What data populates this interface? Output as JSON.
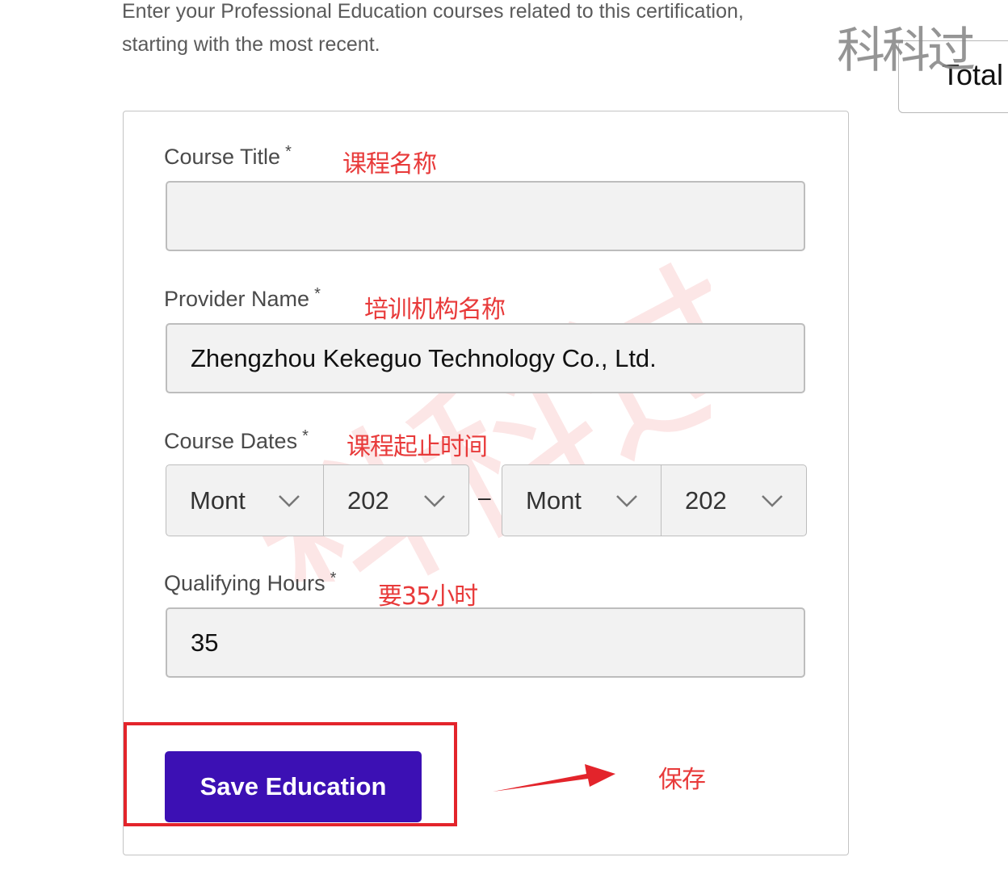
{
  "intro": {
    "line1": "Enter your Professional Education courses related to this certification,",
    "line2": "starting with the most recent."
  },
  "corner": {
    "logo_text": "科科过",
    "total_label": "Total"
  },
  "form": {
    "course_title": {
      "label": "Course Title",
      "required": "*",
      "note": "课程名称",
      "value": ""
    },
    "provider_name": {
      "label": "Provider Name",
      "required": "*",
      "note": "培训机构名称",
      "value": "Zhengzhou Kekeguo Technology Co., Ltd."
    },
    "course_dates": {
      "label": "Course Dates",
      "required": "*",
      "note": "课程起止时间",
      "start_month": "Mont",
      "start_year": "202",
      "separator": "–",
      "end_month": "Mont",
      "end_year": "202"
    },
    "qualifying_hours": {
      "label": "Qualifying Hours",
      "required": "*",
      "note": "要35小时",
      "value": "35"
    },
    "save_button": "Save Education",
    "save_note": "保存"
  },
  "watermark": {
    "text": "科科过"
  },
  "colors": {
    "accent": "#3c10b4",
    "annotation": "#e3242b",
    "field_bg": "#f2f2f2"
  },
  "icons": {
    "select_chevron": "chevron-down-icon",
    "annotation_arrow": "arrow-right-icon"
  }
}
